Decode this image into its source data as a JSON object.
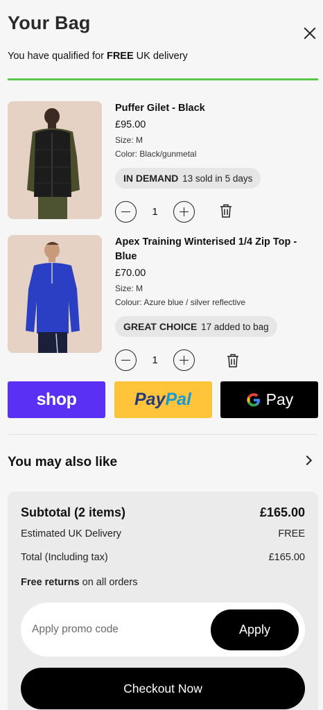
{
  "header": {
    "title": "Your Bag",
    "delivery_prefix": "You have qualified for ",
    "delivery_bold": "FREE",
    "delivery_suffix": " UK delivery",
    "delivery_progress": 1.0
  },
  "items": [
    {
      "name": "Puffer Gilet - Black",
      "price": "£95.00",
      "size": "Size: M",
      "color": "Color: Black/gunmetal",
      "badge_bold": "IN DEMAND",
      "badge_text": "13 sold in 5 days",
      "quantity": "1"
    },
    {
      "name": "Apex Training Winterised 1/4 Zip Top - Blue",
      "price": "£70.00",
      "size": "Size: M",
      "color": "Colour: Azure blue / silver reflective",
      "badge_bold": "GREAT CHOICE",
      "badge_text": "17 added to bag",
      "quantity": "1"
    }
  ],
  "payments": {
    "shop": "shop",
    "paypal_a": "Pay",
    "paypal_b": "Pal",
    "gpay_g": "G",
    "gpay_text": "Pay"
  },
  "recommendations": {
    "title": "You may also like"
  },
  "summary": {
    "subtotal_label": "Subtotal (2 items)",
    "subtotal_value": "£165.00",
    "delivery_label": "Estimated UK Delivery",
    "delivery_value": "FREE",
    "total_label": "Total (Including tax)",
    "total_value": "£165.00",
    "returns_bold": "Free returns",
    "returns_text": " on all orders",
    "promo_placeholder": "Apply promo code",
    "apply_label": "Apply",
    "checkout_label": "Checkout Now"
  },
  "colors": {
    "accent_green": "#5cc74c",
    "shop_purple": "#5a31f4",
    "paypal_yellow": "#ffc439",
    "thumb_bg": "#e8d5c9"
  },
  "icons": [
    "close-icon",
    "minus-icon",
    "plus-icon",
    "trash-icon",
    "chevron-right-icon"
  ]
}
